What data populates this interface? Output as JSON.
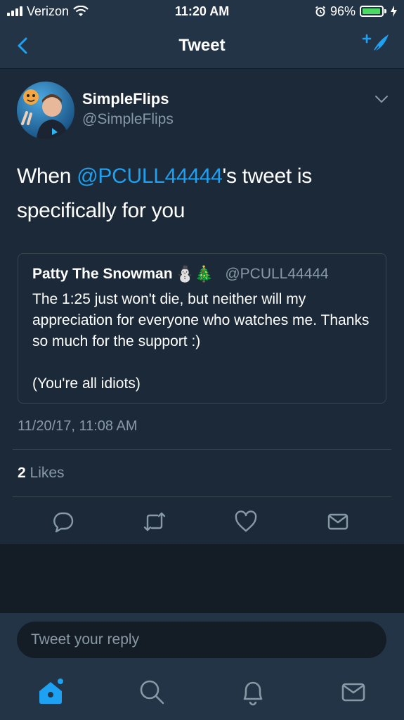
{
  "status_bar": {
    "carrier": "Verizon",
    "time": "11:20 AM",
    "battery_percent": "96%",
    "battery_level": 0.96,
    "icons": [
      "signal-icon",
      "wifi-icon",
      "alarm-icon",
      "battery-icon",
      "charging-icon"
    ]
  },
  "nav": {
    "title": "Tweet",
    "back_icon": "chevron-left-icon",
    "compose_icon": "compose-tweet-icon"
  },
  "tweet": {
    "author_name": "SimpleFlips",
    "author_handle": "@SimpleFlips",
    "text_before": "When ",
    "mention": "@PCULL44444",
    "text_after": "'s tweet is specifically for you",
    "quoted": {
      "name": "Patty The Snowman",
      "emoji": "⛄🎄",
      "handle": "@PCULL44444",
      "text": "The 1:25 just won't die, but neither will my appreciation for everyone who watches me. Thanks so much for the support :)\n\n(You're all idiots)"
    },
    "timestamp": "11/20/17, 11:08 AM",
    "likes_count": "2",
    "likes_label": "Likes"
  },
  "actions": [
    "reply-icon",
    "retweet-icon",
    "like-icon",
    "share-icon"
  ],
  "reply": {
    "placeholder": "Tweet your reply"
  },
  "tabs": [
    "home-icon",
    "search-icon",
    "notifications-icon",
    "messages-icon"
  ],
  "colors": {
    "accent": "#1da1f2",
    "background": "#1c2938",
    "bar": "#243447",
    "muted": "#8899a6"
  }
}
